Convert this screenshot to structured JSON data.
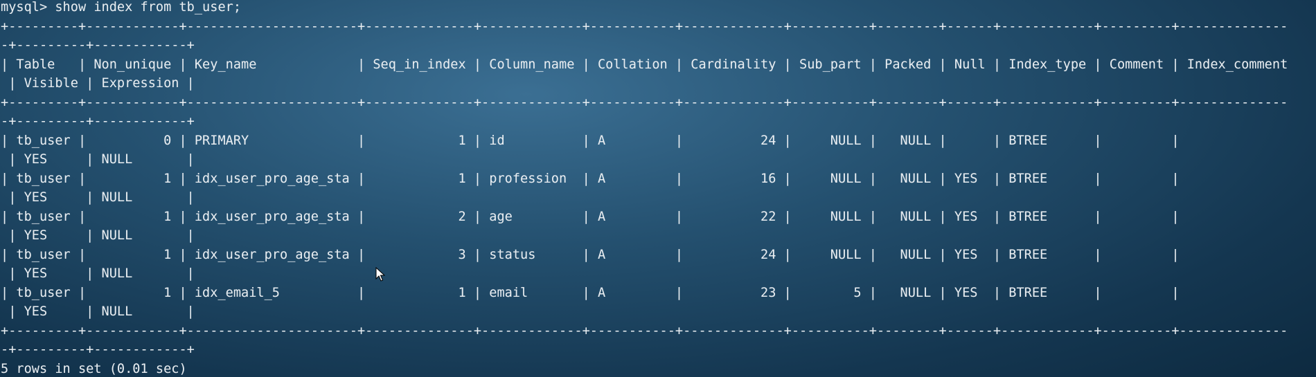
{
  "terminal": {
    "lines": [
      "mysql> show index from tb_user;",
      "+---------+------------+----------------------+--------------+-------------+-----------+-------------+----------+--------+------+------------+---------+--------------",
      "-+---------+------------+",
      "| Table   | Non_unique | Key_name             | Seq_in_index | Column_name | Collation | Cardinality | Sub_part | Packed | Null | Index_type | Comment | Index_comment",
      " | Visible | Expression |",
      "+---------+------------+----------------------+--------------+-------------+-----------+-------------+----------+--------+------+------------+---------+--------------",
      "-+---------+------------+",
      "| tb_user |          0 | PRIMARY              |            1 | id          | A         |          24 |     NULL |   NULL |      | BTREE      |         |",
      " | YES     | NULL       |",
      "| tb_user |          1 | idx_user_pro_age_sta |            1 | profession  | A         |          16 |     NULL |   NULL | YES  | BTREE      |         |",
      " | YES     | NULL       |",
      "| tb_user |          1 | idx_user_pro_age_sta |            2 | age         | A         |          22 |     NULL |   NULL | YES  | BTREE      |         |",
      " | YES     | NULL       |",
      "| tb_user |          1 | idx_user_pro_age_sta |            3 | status      | A         |          24 |     NULL |   NULL | YES  | BTREE      |         |",
      " | YES     | NULL       |",
      "| tb_user |          1 | idx_email_5          |            1 | email       | A         |          23 |        5 |   NULL | YES  | BTREE      |         |",
      " | YES     | NULL       |",
      "+---------+------------+----------------------+--------------+-------------+-----------+-------------+----------+--------+------+------------+---------+--------------",
      "-+---------+------------+",
      "5 rows in set (0.01 sec)"
    ]
  }
}
